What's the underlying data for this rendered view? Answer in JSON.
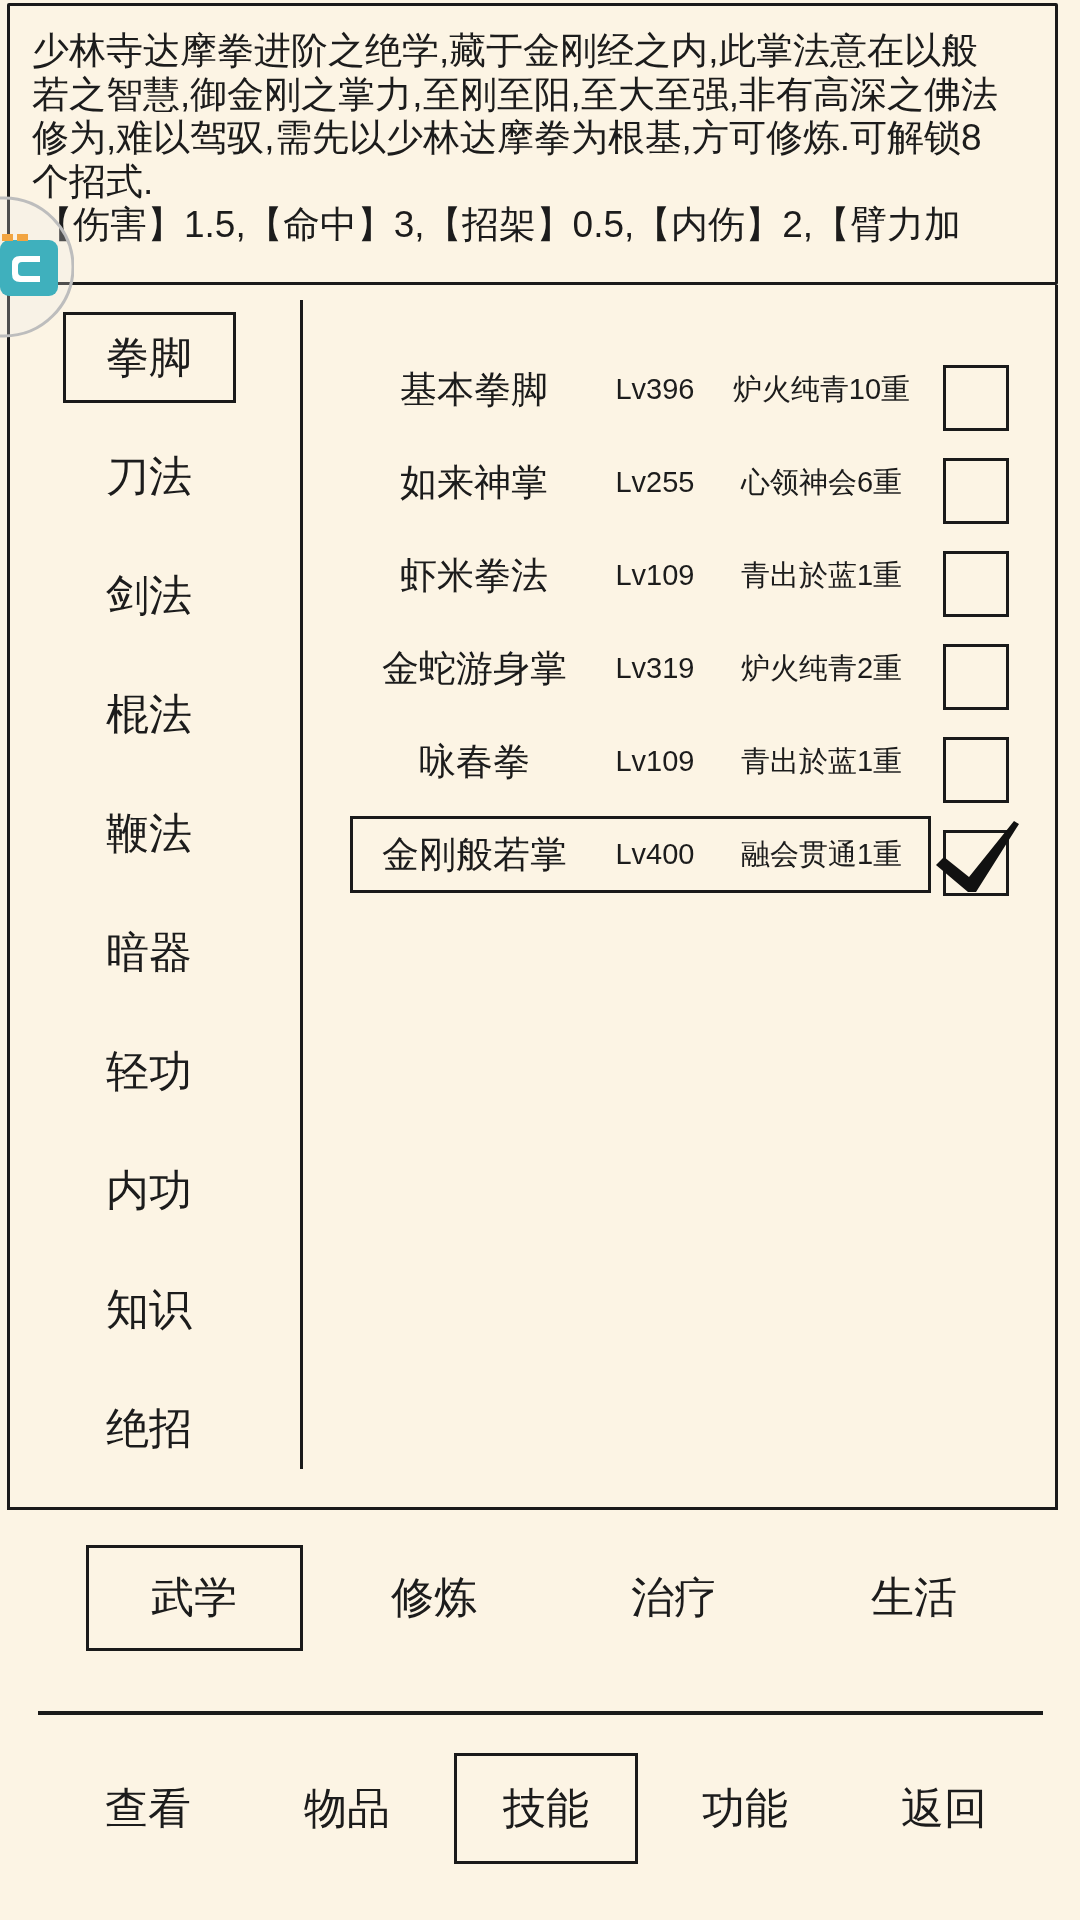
{
  "description": {
    "text": "少林寺达摩拳进阶之绝学,藏于金刚经之内,此掌法意在以般若之智慧,御金刚之掌力,至刚至阳,至大至强,非有高深之佛法修为,难以驾驭,需先以少林达摩拳为根基,方可修炼.可解锁8个招式.",
    "stats": "【伤害】1.5,【命中】3,【招架】0.5,【内伤】2,【臂力加"
  },
  "categories": [
    {
      "label": "拳脚",
      "selected": true
    },
    {
      "label": "刀法",
      "selected": false
    },
    {
      "label": "剑法",
      "selected": false
    },
    {
      "label": "棍法",
      "selected": false
    },
    {
      "label": "鞭法",
      "selected": false
    },
    {
      "label": "暗器",
      "selected": false
    },
    {
      "label": "轻功",
      "selected": false
    },
    {
      "label": "内功",
      "selected": false
    },
    {
      "label": "知识",
      "selected": false
    },
    {
      "label": "绝招",
      "selected": false
    }
  ],
  "skills": [
    {
      "name": "基本拳脚",
      "level_text": "Lv396",
      "realm": "炉火纯青10重",
      "selected": false,
      "checked": false
    },
    {
      "name": "如来神掌",
      "level_text": "Lv255",
      "realm": "心领神会6重",
      "selected": false,
      "checked": false
    },
    {
      "name": "虾米拳法",
      "level_text": "Lv109",
      "realm": "青出於蓝1重",
      "selected": false,
      "checked": false
    },
    {
      "name": "金蛇游身掌",
      "level_text": "Lv319",
      "realm": "炉火纯青2重",
      "selected": false,
      "checked": false
    },
    {
      "name": "咏春拳",
      "level_text": "Lv109",
      "realm": "青出於蓝1重",
      "selected": false,
      "checked": false
    },
    {
      "name": "金刚般若掌",
      "level_text": "Lv400",
      "realm": "融会贯通1重",
      "selected": true,
      "checked": true
    }
  ],
  "tabs": [
    {
      "label": "武学",
      "selected": true
    },
    {
      "label": "修炼",
      "selected": false
    },
    {
      "label": "治疗",
      "selected": false
    },
    {
      "label": "生活",
      "selected": false
    }
  ],
  "nav": [
    {
      "label": "查看",
      "selected": false
    },
    {
      "label": "物品",
      "selected": false
    },
    {
      "label": "技能",
      "selected": true
    },
    {
      "label": "功能",
      "selected": false
    },
    {
      "label": "返回",
      "selected": false
    }
  ]
}
